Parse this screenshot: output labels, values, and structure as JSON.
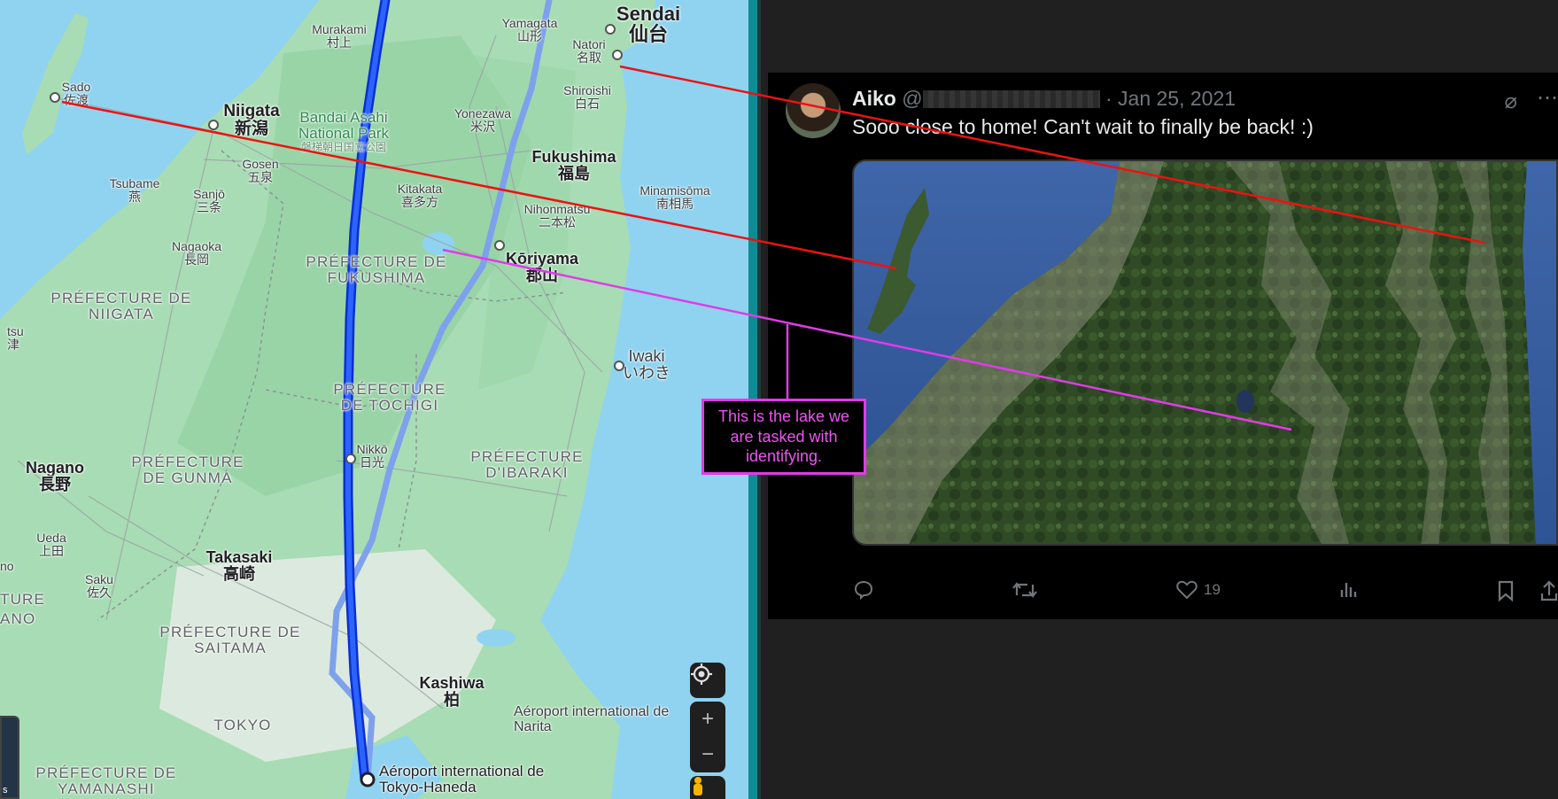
{
  "map": {
    "cities": [
      {
        "name": "Sendai",
        "jp": "仙台"
      },
      {
        "name": "Murakami",
        "jp": "村上"
      },
      {
        "name": "Yamagata",
        "jp": "山形"
      },
      {
        "name": "Natori",
        "jp": "名取"
      },
      {
        "name": "Sado",
        "jp": "佐渡"
      },
      {
        "name": "Niigata",
        "jp": "新潟"
      },
      {
        "name": "Shiroishi",
        "jp": "白石"
      },
      {
        "name": "Yonezawa",
        "jp": "米沢"
      },
      {
        "name": "Gosen",
        "jp": "五泉"
      },
      {
        "name": "Tsubame",
        "jp": "燕"
      },
      {
        "name": "Sanjō",
        "jp": "三条"
      },
      {
        "name": "Kitakata",
        "jp": "喜多方"
      },
      {
        "name": "Fukushima",
        "jp": "福島"
      },
      {
        "name": "Minamisōma",
        "jp": "南相馬"
      },
      {
        "name": "Nihonmatsu",
        "jp": "二本松"
      },
      {
        "name": "Nagaoka",
        "jp": "長岡"
      },
      {
        "name": "Kōriyama",
        "jp": "郡山"
      },
      {
        "name": "Iwaki",
        "jp": "いわき"
      },
      {
        "name": "Nikkō",
        "jp": "日光"
      },
      {
        "name": "Nagano",
        "jp": "長野"
      },
      {
        "name": "Ueda",
        "jp": "上田"
      },
      {
        "name": "Takasaki",
        "jp": "高崎"
      },
      {
        "name": "Saku",
        "jp": "佐久"
      },
      {
        "name": "Kashiwa",
        "jp": "柏"
      }
    ],
    "park": {
      "name": "Bandai Asahi National Park",
      "jp": "磐梯朝日国立公園"
    },
    "prefectures": [
      "PRÉFECTURE DE FUKUSHIMA",
      "PRÉFECTURE DE NIIGATA",
      "PRÉFECTURE DE TOCHIGI",
      "PRÉFECTURE DE GUNMA",
      "PRÉFECTURE D'IBARAKI",
      "PRÉFECTURE DE SAITAMA",
      "TOKYO",
      "PRÉFECTURE DE YAMANASHI"
    ],
    "airports": [
      "Aéroport international de Narita",
      "Aéroport international de Tokyo-Haneda"
    ],
    "edge_labels": {
      "tsu": "tsu",
      "tsu_jp": "津",
      "no": "no",
      "ture": "TURE",
      "ano": "ANO"
    },
    "thumb_label": "s",
    "zoom_in": "+",
    "zoom_out": "−"
  },
  "tweet": {
    "name": "Aiko",
    "handle_prefix": "@",
    "separator": "·",
    "date": "Jan 25, 2021",
    "text": "Sooo close to home! Can't wait to finally be back! :)",
    "likes": "19"
  },
  "callout": {
    "text": "This is the lake we are tasked with identifying."
  },
  "colors": {
    "route_primary": "#1a4fe8",
    "route_alt": "#7ea1ec",
    "annotation_red": "#ee1111",
    "annotation_magenta": "#e23ae8"
  }
}
